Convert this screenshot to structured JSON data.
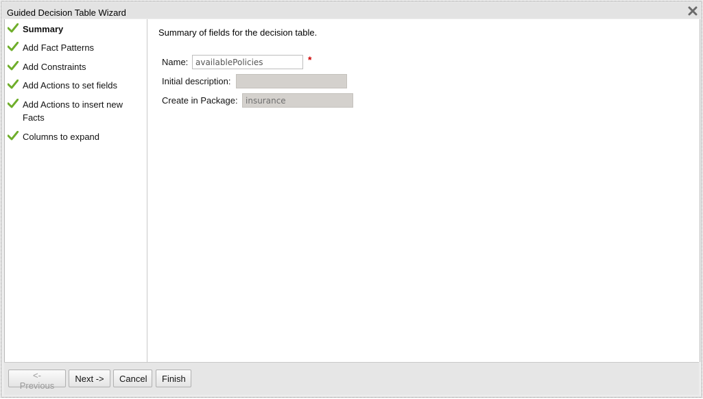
{
  "dialog": {
    "title": "Guided Decision Table Wizard",
    "close_icon": "close-icon"
  },
  "steps": [
    {
      "label": "Summary",
      "active": true
    },
    {
      "label": "Add Fact Patterns",
      "active": false
    },
    {
      "label": "Add Constraints",
      "active": false
    },
    {
      "label": "Add Actions to set fields",
      "active": false
    },
    {
      "label": "Add Actions to insert new Facts",
      "active": false
    },
    {
      "label": "Columns to expand",
      "active": false
    }
  ],
  "main": {
    "summary_text": "Summary of fields for the decision table.",
    "fields": {
      "name_label": "Name:",
      "name_value": "availablePolicies",
      "required_marker": "*",
      "description_label": "Initial description:",
      "description_value": "",
      "package_label": "Create in Package:",
      "package_value": "insurance"
    }
  },
  "footer": {
    "previous_label": "<- Previous",
    "next_label": "Next ->",
    "cancel_label": "Cancel",
    "finish_label": "Finish"
  },
  "colors": {
    "check": "#6fae2b",
    "required": "#cc0000"
  }
}
